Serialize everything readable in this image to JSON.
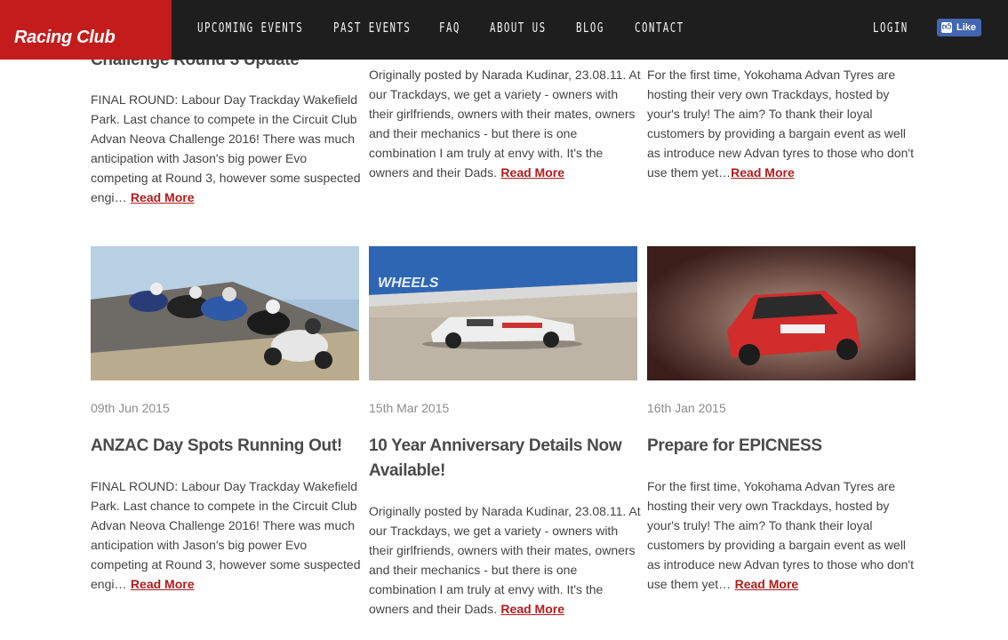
{
  "brand": {
    "name": "Racing Club",
    "color": "#c41c1c"
  },
  "nav": {
    "items": [
      {
        "label": "UPCOMING EVENTS"
      },
      {
        "label": "PAST EVENTS"
      },
      {
        "label": "FAQ"
      },
      {
        "label": "ABOUT US"
      },
      {
        "label": "BLOG"
      },
      {
        "label": "CONTACT"
      }
    ],
    "login": "LOGIN",
    "fb_like": "Like"
  },
  "read_more": "Read More",
  "top_row": [
    {
      "title_fragment": "Challenge Round 3 Update",
      "excerpt": "FINAL ROUND: Labour Day Trackday Wakefield Park. Last chance to compete in the Circuit Club Advan Neova Challenge 2016! There was much anticipation with Jason's big power Evo competing at Round 3, however some suspected engi…"
    },
    {
      "excerpt": "Originally posted by Narada Kudinar, 23.08.11. At our Trackdays, we get a variety - owners with their girlfriends, owners with their mates, owners and their mechanics - but there is one combination I am truly at envy with. It's the owners and their Dads."
    },
    {
      "excerpt": "For the first time, Yokohama Advan Tyres are hosting their very own Trackdays, hosted by your's truly! The aim? To thank their loyal customers by providing a bargain event as well as introduce new Advan tyres to those who don't use them yet…"
    }
  ],
  "posts": [
    {
      "date": "09th Jun 2015",
      "title": "ANZAC Day Spots Running Out!",
      "excerpt": "FINAL ROUND: Labour Day Trackday Wakefield Park. Last chance to compete in the Circuit Club Advan Neova Challenge 2016! There was much anticipation with Jason's big power Evo competing at Round 3, however some suspected engi…",
      "image": "motorcycles-racing-photo"
    },
    {
      "date": "15th Mar 2015",
      "title": "10 Year Anniversary Details Now Available!",
      "excerpt": "Originally posted by Narada Kudinar, 23.08.11. At our Trackdays, we get a variety - owners with their girlfriends, owners with their mates, owners and their mechanics - but there is one combination I am truly at envy with. It's the owners and their Dads.",
      "image": "prototype-race-car-photo",
      "image_text": "WHEELS"
    },
    {
      "date": "16th Jan 2015",
      "title": "Prepare for EPICNESS",
      "excerpt": "For the first time, Yokohama Advan Tyres are hosting their very own Trackdays, hosted by your's truly! The aim? To thank their loyal customers by providing a bargain event as well as introduce new Advan tyres to those who don't use them yet…",
      "image": "rally-car-photo"
    }
  ]
}
